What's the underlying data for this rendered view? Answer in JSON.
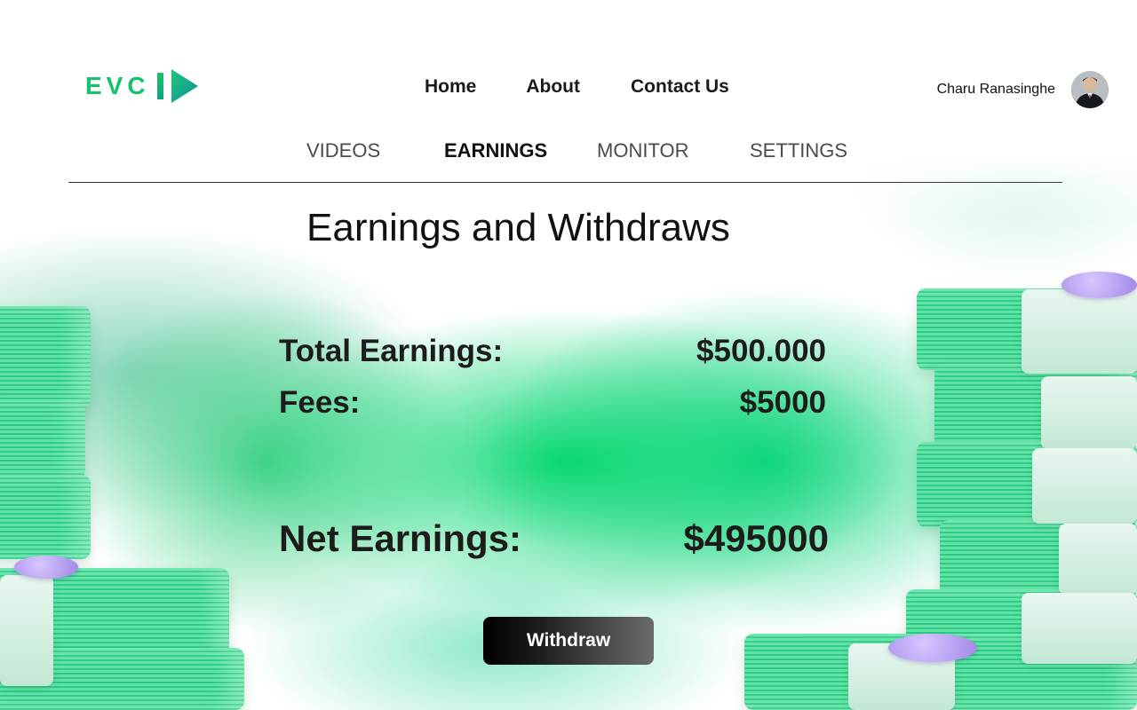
{
  "header": {
    "logo_text": "EVC",
    "nav": {
      "home": "Home",
      "about": "About",
      "contact": "Contact Us"
    },
    "user": {
      "name": "Charu Ranasinghe"
    }
  },
  "tabs": {
    "videos": "VIDEOS",
    "earnings": "EARNINGS",
    "monitor": "MONITOR",
    "settings": "SETTINGS",
    "active": "EARNINGS"
  },
  "main": {
    "title": "Earnings and Withdraws",
    "total_earnings_label": "Total Earnings:",
    "total_earnings_value": "$500.000",
    "fees_label": "Fees:",
    "fees_value": "$5000",
    "net_earnings_label": "Net Earnings:",
    "net_earnings_value": "$495000",
    "withdraw_label": "Withdraw"
  },
  "colors": {
    "brand_green": "#14c26a",
    "background_green": "#00d66e",
    "button_dark": "#000000"
  },
  "icons": {
    "logo_mark": "play-triangle-icon",
    "decoration": "money-stack-icon"
  }
}
